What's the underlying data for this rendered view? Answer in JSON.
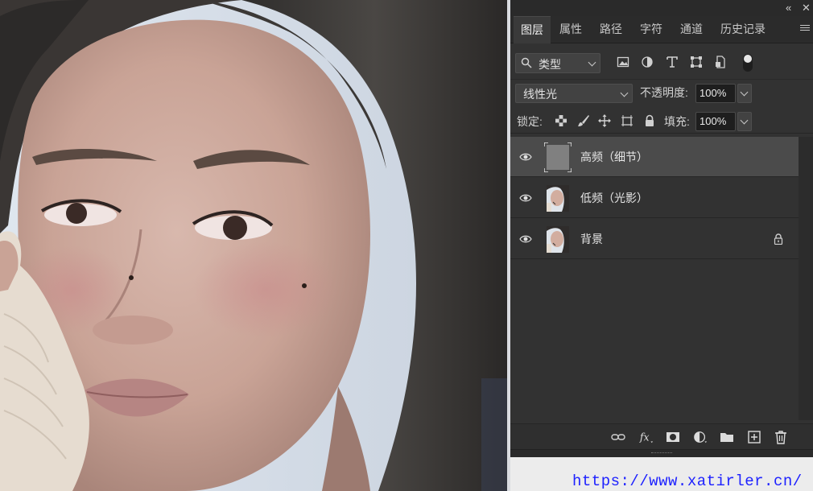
{
  "panel": {
    "collapse_label": "«",
    "close_label": "✕"
  },
  "tabs": [
    {
      "label": "图层",
      "active": true
    },
    {
      "label": "属性"
    },
    {
      "label": "路径"
    },
    {
      "label": "字符"
    },
    {
      "label": "通道"
    },
    {
      "label": "历史记录"
    }
  ],
  "filter": {
    "kind_label": "类型",
    "icons": [
      "pixel-filter-icon",
      "adjustment-filter-icon",
      "type-filter-icon",
      "shape-filter-icon",
      "smart-object-filter-icon"
    ]
  },
  "blend": {
    "mode": "线性光",
    "opacity_label": "不透明度:",
    "opacity_value": "100%"
  },
  "lock": {
    "label": "锁定:",
    "fill_label": "填充:",
    "fill_value": "100%"
  },
  "layers": [
    {
      "name": "高频（细节）",
      "selected": true,
      "thumb": "gray",
      "locked": false
    },
    {
      "name": "低频（光影）",
      "selected": false,
      "thumb": "photo",
      "locked": false
    },
    {
      "name": "背景",
      "selected": false,
      "thumb": "photo",
      "locked": true
    }
  ],
  "footer_icons": [
    "link-layers-icon",
    "fx-icon",
    "mask-icon",
    "adjustment-layer-icon",
    "group-folder-icon",
    "new-layer-icon",
    "trash-icon"
  ],
  "watermark": "https://www.xatirler.cn/",
  "colors": {
    "panel_bg": "#323232",
    "selected_row": "#4b4b4b",
    "watermark": "#1e22ff"
  }
}
